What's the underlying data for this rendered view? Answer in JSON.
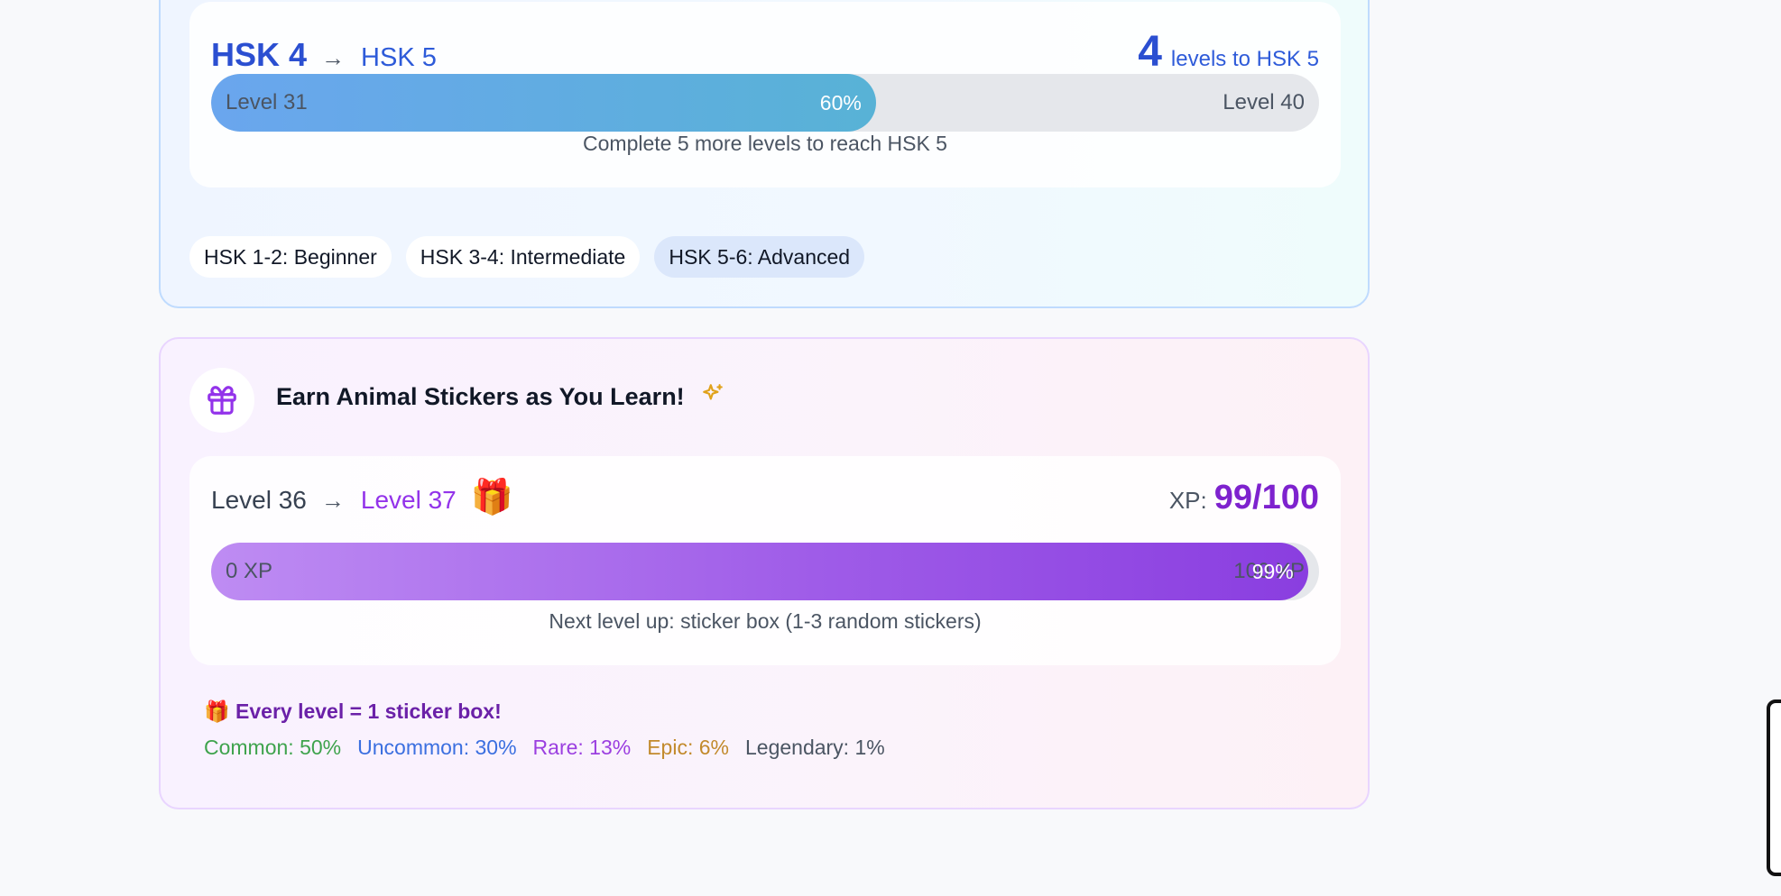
{
  "hsk": {
    "current": "HSK 4",
    "arrow": "→",
    "next": "HSK 5",
    "levels_remaining": "4",
    "levels_remaining_label": "levels to HSK 5",
    "progress": {
      "start_label": "Level 31",
      "end_label": "Level 40",
      "percent_label": "60%",
      "fraction": 0.6,
      "caption": "Complete 5 more levels to reach HSK 5"
    },
    "tags": [
      {
        "label": "HSK 1-2: Beginner",
        "active": false
      },
      {
        "label": "HSK 3-4: Intermediate",
        "active": false
      },
      {
        "label": "HSK 5-6: Advanced",
        "active": true
      }
    ]
  },
  "stickers": {
    "title": "Earn Animal Stickers as You Learn!",
    "icons": {
      "header": "gift-icon",
      "sparkle": "sparkles-icon"
    },
    "level_current": "Level 36",
    "arrow": "→",
    "level_next": "Level 37",
    "gift_emoji": "🎁",
    "xp_label": "XP:",
    "xp_value": "99/100",
    "bar": {
      "start_label": "0 XP",
      "end_label": "100 XP",
      "percent_label": "99%",
      "fraction": 0.99
    },
    "caption": "Next level up: sticker box (1-3 random stickers)",
    "every_level": "🎁 Every level = 1 sticker box!",
    "rarities": [
      {
        "label": "Common: 50%",
        "color": "#4b5563"
      },
      {
        "label": "Uncommon: 30%",
        "color": "#3fa34d"
      },
      {
        "label": "Rare: 13%",
        "color": "#3b6fe0"
      },
      {
        "label": "Epic: 6%",
        "color": "#9b3fe0"
      },
      {
        "label": "Legendary: 1%",
        "color": "#c28a2c"
      }
    ]
  },
  "colors": {
    "hsk_accent": "#2b4fd1",
    "xp_accent": "#7e22ce"
  }
}
